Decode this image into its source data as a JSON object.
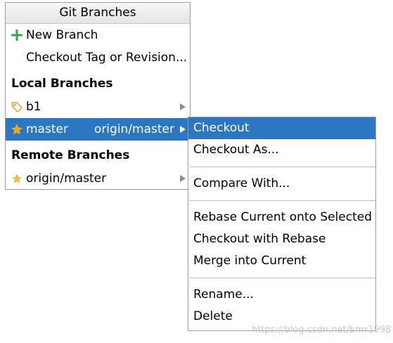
{
  "popup": {
    "title": "Git Branches",
    "actions": [
      {
        "label": "New Branch",
        "icon": "plus-icon"
      },
      {
        "label": "Checkout Tag or Revision..."
      }
    ],
    "local_header": "Local Branches",
    "local": [
      {
        "label": "b1",
        "icon": "tag-icon"
      },
      {
        "label": "master",
        "tracking": "origin/master",
        "icon": "star-icon",
        "selected": true
      }
    ],
    "remote_header": "Remote Branches",
    "remote": [
      {
        "label": "origin/master",
        "icon": "star-icon"
      }
    ]
  },
  "submenu": {
    "items": [
      {
        "label": "Checkout",
        "selected": true
      },
      {
        "label": "Checkout As..."
      },
      {
        "label": "Compare With..."
      },
      {
        "label": "Rebase Current onto Selected"
      },
      {
        "label": "Checkout with Rebase"
      },
      {
        "label": "Merge into Current"
      },
      {
        "label": "Rename..."
      },
      {
        "label": "Delete"
      }
    ]
  },
  "watermark": "https://blog.csdn.net/bmr1998",
  "colors": {
    "selection": "#2d77c2",
    "plus": "#3aa24a",
    "star": "#f5a623",
    "tag": "#e0a23a",
    "separator": "#b9b9b9"
  }
}
